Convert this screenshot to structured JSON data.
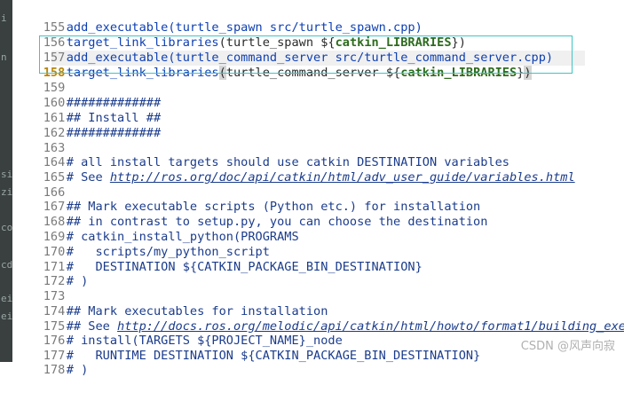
{
  "sidebar_fragments": [
    "i",
    "n",
    "si",
    "zi",
    "co",
    "cd",
    "ei",
    "ei"
  ],
  "lines": [
    {
      "n": "155",
      "text": "add_executable(turtle_spawn src/turtle_spawn.cpp)"
    },
    {
      "n": "156",
      "t1": "target_link_libraries",
      "t2": "(turtle_spawn ${",
      "t3": "catkin_LIBRARIES",
      "t4": "})"
    },
    {
      "n": "157",
      "text": "add_executable(turtle_command_server src/turtle_command_server.cpp)"
    },
    {
      "n": "158",
      "t1": "target_link_libraries",
      "t2": "(",
      "t3": "turtle_command_server ${",
      "t4": "catkin_LIBRARIES",
      "t5": "}",
      "t6": ")"
    },
    {
      "n": "159",
      "text": ""
    },
    {
      "n": "160",
      "text": "#############"
    },
    {
      "n": "161",
      "text": "## Install ##"
    },
    {
      "n": "162",
      "text": "#############"
    },
    {
      "n": "163",
      "text": ""
    },
    {
      "n": "164",
      "text": "# all install targets should use catkin DESTINATION variables"
    },
    {
      "n": "165",
      "t1": "# See ",
      "t2": "http://ros.org/doc/api/catkin/html/adv_user_guide/variables.html"
    },
    {
      "n": "166",
      "text": ""
    },
    {
      "n": "167",
      "text": "## Mark executable scripts (Python etc.) for installation"
    },
    {
      "n": "168",
      "text": "## in contrast to setup.py, you can choose the destination"
    },
    {
      "n": "169",
      "text": "# catkin_install_python(PROGRAMS"
    },
    {
      "n": "170",
      "text": "#   scripts/my_python_script"
    },
    {
      "n": "171",
      "text": "#   DESTINATION ${CATKIN_PACKAGE_BIN_DESTINATION}"
    },
    {
      "n": "172",
      "text": "# )"
    },
    {
      "n": "173",
      "text": ""
    },
    {
      "n": "174",
      "text": "## Mark executables for installation"
    },
    {
      "n": "175",
      "t1": "## See ",
      "t2": "http://docs.ros.org/melodic/api/catkin/html/howto/format1/building_exec"
    },
    {
      "n": "176",
      "text": "# install(TARGETS ${PROJECT_NAME}_node"
    },
    {
      "n": "177",
      "text": "#   RUNTIME DESTINATION ${CATKIN_PACKAGE_BIN_DESTINATION}"
    },
    {
      "n": "178",
      "text": "# )"
    }
  ],
  "watermark": "CSDN @风声向寂"
}
